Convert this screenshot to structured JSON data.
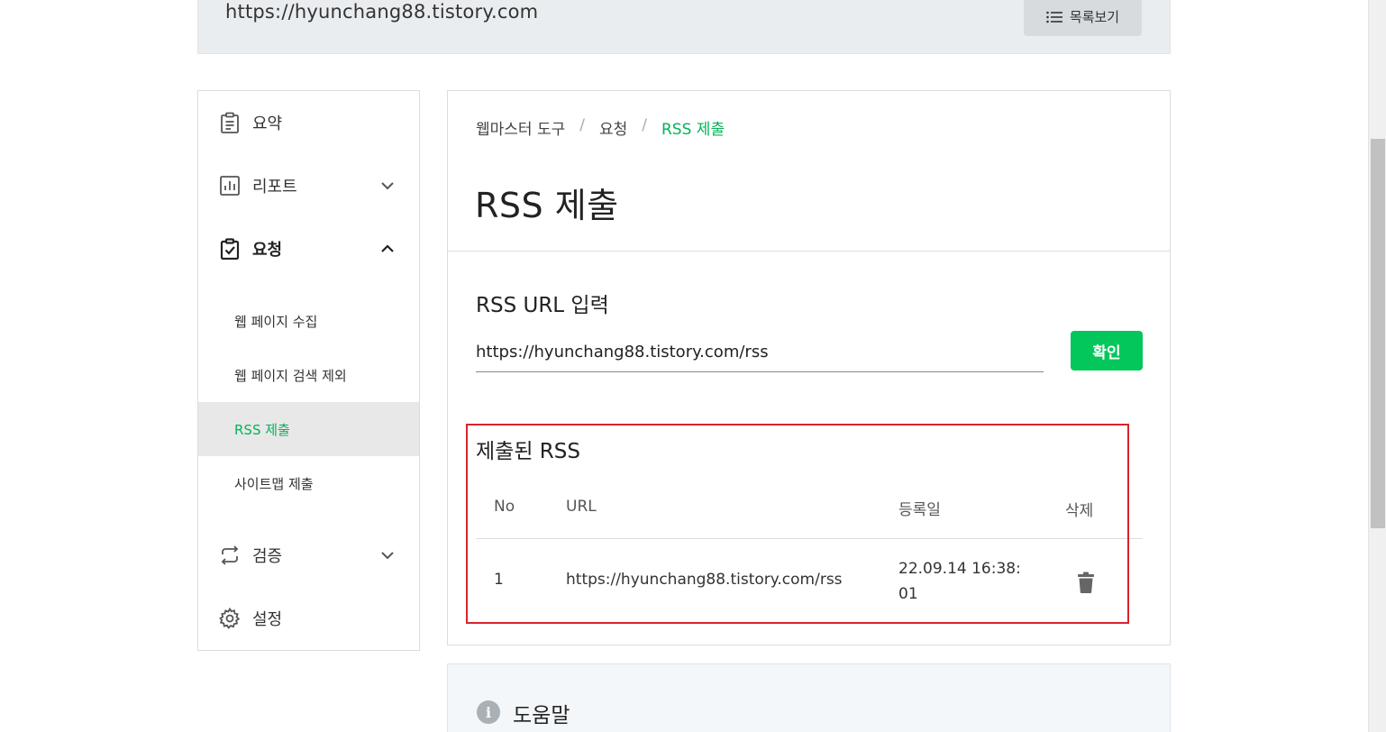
{
  "site": {
    "url": "https://hyunchang88.tistory.com",
    "list_button": "목록보기"
  },
  "sidebar": {
    "items": [
      {
        "label": "요약",
        "icon": "clipboard-icon"
      },
      {
        "label": "리포트",
        "icon": "bar-chart-icon"
      },
      {
        "label": "요청",
        "icon": "clipboard-check-icon"
      },
      {
        "label": "검증",
        "icon": "repeat-icon"
      },
      {
        "label": "설정",
        "icon": "gear-icon"
      }
    ],
    "sub_items": [
      {
        "label": "웹 페이지 수집"
      },
      {
        "label": "웹 페이지 검색 제외"
      },
      {
        "label": "RSS 제출"
      },
      {
        "label": "사이트맵 제출"
      }
    ]
  },
  "breadcrumb": {
    "items": [
      "웹마스터 도구",
      "요청",
      "RSS 제출"
    ],
    "separator": "/"
  },
  "main": {
    "title": "RSS 제출",
    "input_section_title": "RSS URL 입력",
    "input_value": "https://hyunchang88.tistory.com/rss",
    "confirm_button": "확인",
    "submitted_title": "제출된 RSS",
    "table": {
      "headers": [
        "No",
        "URL",
        "등록일",
        "삭제"
      ],
      "rows": [
        {
          "no": "1",
          "url": "https://hyunchang88.tistory.com/rss",
          "date_line1": "22.09.14 16:38:",
          "date_line2": "01"
        }
      ]
    }
  },
  "help": {
    "title": "도움말",
    "icon_glyph": "i"
  },
  "colors": {
    "accent": "#03c75a",
    "highlight": "#d9232d"
  }
}
